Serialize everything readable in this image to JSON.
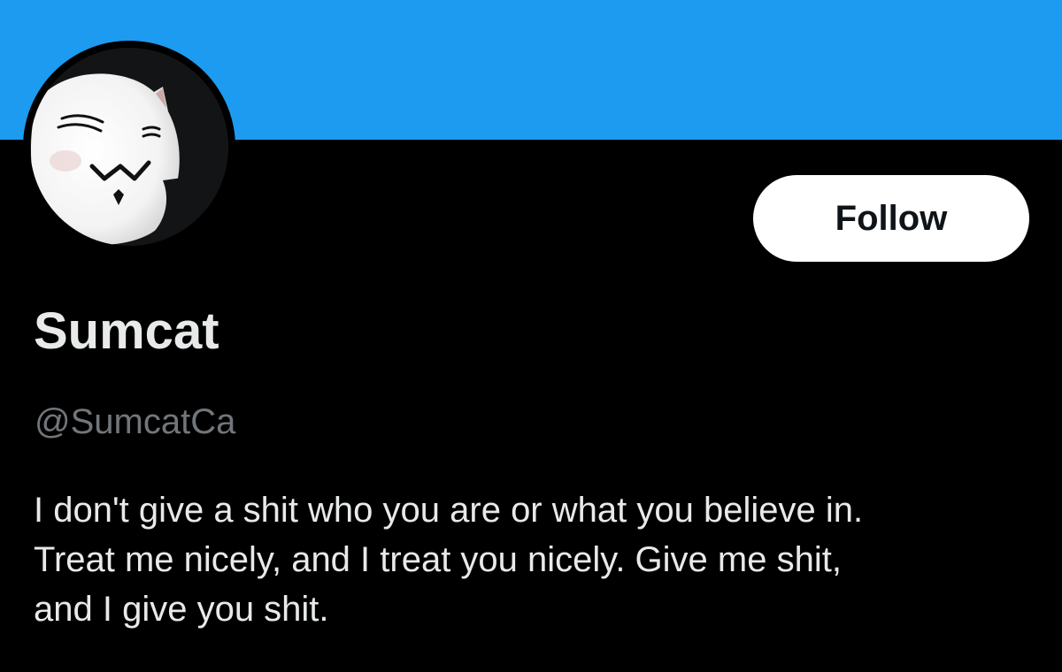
{
  "colors": {
    "banner": "#1d9bf0",
    "background": "#000000",
    "primary_text": "#e7e9ea",
    "secondary_text": "#71767b",
    "follow_button_bg": "#ffffff",
    "follow_button_text": "#0f1419"
  },
  "profile": {
    "display_name": "Sumcat",
    "handle": "@SumcatCa",
    "avatar_icon": "cat-face-avatar",
    "follow_label": "Follow",
    "bio_lines": [
      "I don't give a shit who you are or what you believe in.",
      "Treat me nicely, and I treat you nicely. Give me shit,",
      "and I give you shit."
    ]
  }
}
